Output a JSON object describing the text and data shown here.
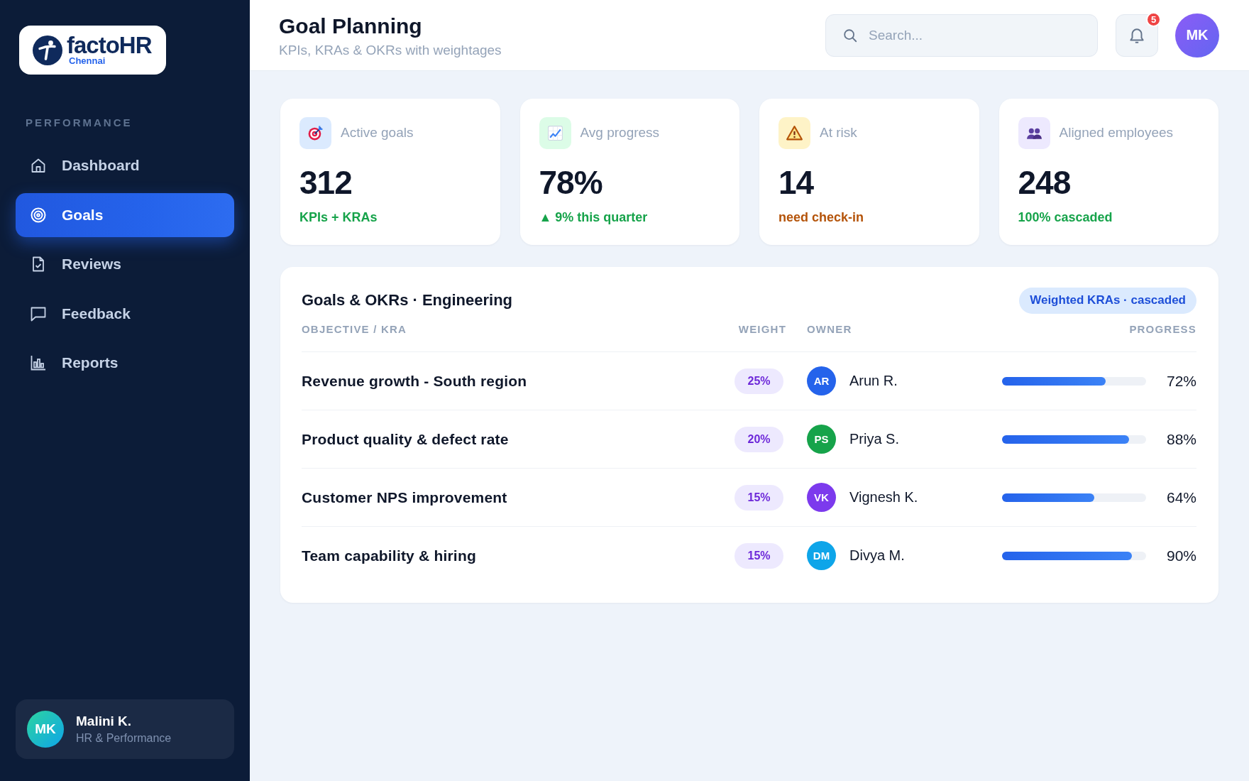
{
  "sidebar": {
    "logo": {
      "name": "factoHR",
      "location": "Chennai"
    },
    "section_label": "PERFORMANCE",
    "items": [
      {
        "label": "Dashboard",
        "selected": false
      },
      {
        "label": "Goals",
        "selected": true
      },
      {
        "label": "Reviews",
        "selected": false
      },
      {
        "label": "Feedback",
        "selected": false
      },
      {
        "label": "Reports",
        "selected": false
      }
    ],
    "user": {
      "initials": "MK",
      "name": "Malini K.",
      "role": "HR & Performance"
    }
  },
  "header": {
    "title": "Goal Planning",
    "subtitle": "KPIs, KRAs & OKRs with weightages",
    "search": {
      "placeholder": "Search..."
    },
    "notifications": {
      "count": "5"
    },
    "avatar": {
      "initials": "MK"
    }
  },
  "stats": [
    {
      "label": "Active goals",
      "value": "312",
      "note": "KPIs + KRAs",
      "warning": false,
      "color": "#dbeafe"
    },
    {
      "label": "Avg progress",
      "value": "78%",
      "note": "▲ 9% this quarter",
      "warning": false,
      "color": "#dcfce7"
    },
    {
      "label": "At risk",
      "value": "14",
      "note": "need check-in",
      "warning": true,
      "color": "#fef3c7"
    },
    {
      "label": "Aligned employees",
      "value": "248",
      "note": "100% cascaded",
      "warning": false,
      "color": "#ede9fe"
    }
  ],
  "goals_table": {
    "title": "Goals & OKRs · Engineering",
    "badge": "Weighted KRAs · cascaded",
    "columns": [
      "OBJECTIVE / KRA",
      "WEIGHT",
      "OWNER",
      "PROGRESS"
    ],
    "rows": [
      {
        "objective": "Revenue growth - South region",
        "weight": "25%",
        "owner": {
          "initials": "AR",
          "name": "Arun R.",
          "color": "#2563eb"
        },
        "level": 0.72,
        "progress": "72%"
      },
      {
        "objective": "Product quality & defect rate",
        "weight": "20%",
        "owner": {
          "initials": "PS",
          "name": "Priya S.",
          "color": "#16a34a"
        },
        "level": 0.88,
        "progress": "88%"
      },
      {
        "objective": "Customer NPS improvement",
        "weight": "15%",
        "owner": {
          "initials": "VK",
          "name": "Vignesh K.",
          "color": "#7c3aed"
        },
        "level": 0.64,
        "progress": "64%"
      },
      {
        "objective": "Team capability & hiring",
        "weight": "15%",
        "owner": {
          "initials": "DM",
          "name": "Divya M.",
          "color": "#0ea5e9"
        },
        "level": 0.9,
        "progress": "90%"
      }
    ]
  }
}
